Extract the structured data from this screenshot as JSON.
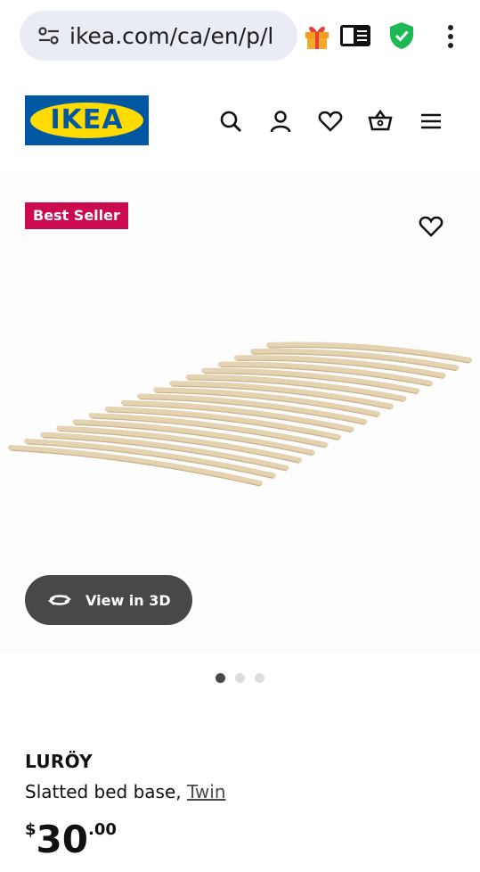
{
  "browser": {
    "url": "ikea.com/ca/en/p/l",
    "icons": [
      "site-settings-icon",
      "gift-icon",
      "reader-mode-icon",
      "shield-icon",
      "more-menu-icon"
    ],
    "shield_color": "#1db954"
  },
  "header": {
    "logo_text": "IKEA",
    "icons": [
      "search-icon",
      "account-icon",
      "favorites-icon",
      "cart-icon",
      "hamburger-menu-icon"
    ],
    "brand_blue": "#0058a3",
    "brand_yellow": "#ffdb00"
  },
  "product": {
    "badge": "Best Seller",
    "badge_color": "#cc0a4f",
    "view_3d_label": "View in 3D",
    "carousel": {
      "total": 3,
      "active": 1
    },
    "name": "LURÖY",
    "description": "Slatted bed base, ",
    "size_link": "Twin",
    "price": {
      "currency": "$",
      "integer": "30",
      "decimal": ".00"
    }
  }
}
